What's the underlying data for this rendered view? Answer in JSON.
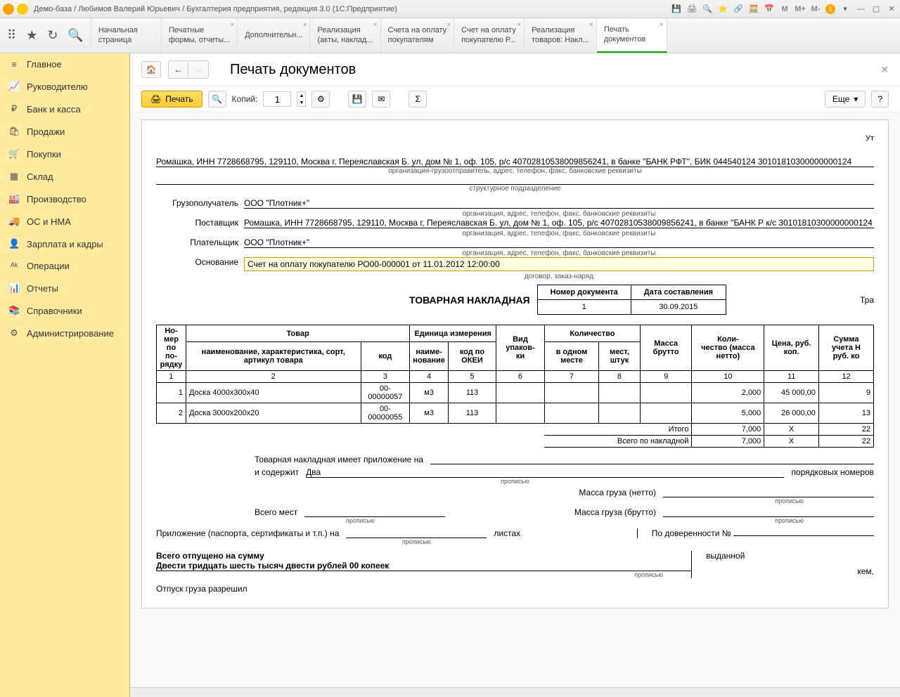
{
  "titlebar": {
    "title": "Демо-база / Любимов Валерий Юрьевич / Бухгалтерия предприятия, редакция 3.0  (1С:Предприятие)",
    "m": "M",
    "mp": "M+",
    "mm": "M-",
    "i": "i"
  },
  "tabs": [
    {
      "l1": "Начальная",
      "l2": "страница"
    },
    {
      "l1": "Печатные",
      "l2": "формы, отчеты..."
    },
    {
      "l1": "Дополнительн...",
      "l2": ""
    },
    {
      "l1": "Реализация",
      "l2": "(акты, наклад..."
    },
    {
      "l1": "Счета на оплату",
      "l2": "покупателям"
    },
    {
      "l1": "Счет на оплату",
      "l2": "покупателю Р..."
    },
    {
      "l1": "Реализация",
      "l2": "товаров: Накл..."
    },
    {
      "l1": "Печать",
      "l2": "документов"
    }
  ],
  "sidebar": [
    {
      "icon": "≡",
      "label": "Главное"
    },
    {
      "icon": "📈",
      "label": "Руководителю"
    },
    {
      "icon": "₽",
      "label": "Банк и касса"
    },
    {
      "icon": "🛍",
      "label": "Продажи"
    },
    {
      "icon": "🛒",
      "label": "Покупки"
    },
    {
      "icon": "▦",
      "label": "Склад"
    },
    {
      "icon": "🏭",
      "label": "Производство"
    },
    {
      "icon": "🚚",
      "label": "ОС и НМА"
    },
    {
      "icon": "👤",
      "label": "Зарплата и кадры"
    },
    {
      "icon": "ᴬᵏ",
      "label": "Операции"
    },
    {
      "icon": "📊",
      "label": "Отчеты"
    },
    {
      "icon": "📚",
      "label": "Справочники"
    },
    {
      "icon": "⚙",
      "label": "Администрирование"
    }
  ],
  "page": {
    "title": "Печать документов",
    "print": "Печать",
    "copies": "Копий:",
    "copies_val": "1",
    "more": "Еще",
    "help": "?",
    "sigma": "Σ"
  },
  "doc": {
    "ut": "Ут",
    "org_line": "Ромашка, ИНН 7728668795, 129110, Москва г, Переяславская Б. ул, дом № 1, оф. 105, р/с 40702810538009856241, в банке \"БАНК РФТ\", БИК 044540124 30101810300000000124",
    "org_help": "организация-грузоотправитель, адрес, телефон, факс, банковские реквизиты",
    "struct_help": "структурное подразделение",
    "consignee_lbl": "Грузополучатель",
    "consignee": "ООО \"Плотник+\"",
    "cons_help": "организация, адрес, телефон, факс, банковские реквизиты",
    "supplier_lbl": "Поставщик",
    "supplier": "Ромашка, ИНН 7728668795, 129110, Москва г, Переяславская Б. ул, дом № 1, оф. 105, р/с 40702810538009856241, в банке \"БАНК Р к/с 30101810300000000124",
    "sup_help": "организация, адрес, телефон, факс, банковские реквизиты",
    "payer_lbl": "Плательщик",
    "payer": "ООО \"Плотник+\"",
    "pay_help": "организация, адрес, телефон, факс, банковские реквизиты",
    "basis_lbl": "Основание",
    "basis": "Счет на оплату покупателю РО00-000001 от 11.01.2012 12:00:00",
    "basis_help": "договор, заказ-наряд",
    "doc_title": "ТОВАРНАЯ НАКЛАДНАЯ",
    "nd_h1": "Номер документа",
    "nd_h2": "Дата составления",
    "nd_v1": "1",
    "nd_v2": "30.09.2015",
    "tra": "Тра",
    "table_headers": {
      "num": "Но-\nмер\nпо по-\nрядку",
      "goods": "Товар",
      "name": "наименование, характеристика, сорт, артикул товара",
      "code": "код",
      "unit": "Единица измерения",
      "unit_name": "наиме-\nнование",
      "okei": "код по ОКЕИ",
      "pack": "Вид упаков-\nки",
      "qty": "Количество",
      "in_one": "в одном месте",
      "places": "мест, штук",
      "mass": "Масса брутто",
      "qty_net": "Коли-\nчество (масса нетто)",
      "price": "Цена, руб. коп.",
      "sum": "Сумма учета Н\nруб. ко"
    },
    "rows": [
      {
        "n": "1",
        "name": "Доска 4000х300х40",
        "code": "00-00000057",
        "unit": "м3",
        "okei": "113",
        "qty": "2,000",
        "price": "45 000,00",
        "sum": "9"
      },
      {
        "n": "2",
        "name": "Доска 3000х200х20",
        "code": "00-00000055",
        "unit": "м3",
        "okei": "113",
        "qty": "5,000",
        "price": "26 000,00",
        "sum": "13"
      }
    ],
    "totals": {
      "itogo": "Итого",
      "itogo_qty": "7,000",
      "x": "X",
      "itogo_sum": "22",
      "total_lbl": "Всего по накладной",
      "total_qty": "7,000",
      "total_sum": "22"
    },
    "app1": "Товарная накладная имеет приложение на",
    "app2": "и содержит",
    "two": "Два",
    "ord_num": "порядковых номеров",
    "prop": "прописью",
    "mass_net": "Масса груза (нетто)",
    "vsego_mest": "Всего мест",
    "mass_br": "Масса груза (брутто)",
    "app3": "Приложение (паспорта, сертификаты и т.п.) на",
    "sheets": "листах",
    "dov": "По доверенности №",
    "issued": "выданной",
    "kem": "кем,",
    "total_label": "Всего отпущено  на сумму",
    "total_words": "Двести тридцать шесть тысяч двести рублей 00 копеек",
    "release": "Отпуск груза разрешил"
  },
  "cols": [
    "1",
    "2",
    "3",
    "4",
    "5",
    "6",
    "7",
    "8",
    "9",
    "10",
    "11",
    "12"
  ]
}
